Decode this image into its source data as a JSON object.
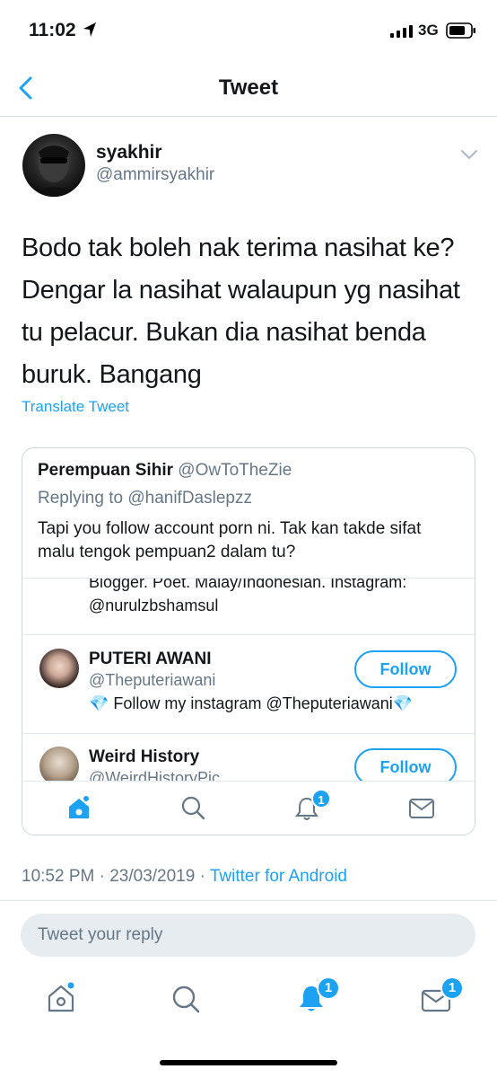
{
  "status_bar": {
    "time": "11:02",
    "network": "3G"
  },
  "nav": {
    "title": "Tweet"
  },
  "tweet": {
    "author_name": "syakhir",
    "author_handle": "@ammirsyakhir",
    "text": "Bodo tak boleh nak terima nasihat ke? Dengar la nasihat walaupun yg nasihat tu pelacur. Bukan dia nasihat benda buruk. Bangang",
    "translate_label": "Translate Tweet",
    "timestamp": "10:52 PM · 23/03/2019 · ",
    "source": "Twitter for Android"
  },
  "quoted": {
    "name": "Perempuan Sihir",
    "handle": "@OwToTheZie",
    "replying_prefix": "Replying to ",
    "replying_to": "@hanifDaslepzz",
    "text": "Tapi you follow account porn ni. Tak kan takde sifat malu tengok pempuan2 dalam tu?",
    "partial_bio": "Blogger. Poet. Malay/Indonesian. Instagram: @nurulzbshamsul",
    "users": [
      {
        "name": "PUTERI AWANI",
        "handle": "@Theputeriawani",
        "bio": "💎 Follow my instagram @Theputeriawani💎",
        "follow_label": "Follow"
      },
      {
        "name": "Weird History",
        "handle": "@WeirdHistoryPic",
        "follow_label": "Follow"
      }
    ],
    "notif_badge": "1"
  },
  "reply": {
    "placeholder": "Tweet your reply"
  },
  "tabbar": {
    "notif_badge": "1",
    "messages_badge": "1"
  },
  "colors": {
    "accent": "#1da1f2",
    "secondary_text": "#657786",
    "divider": "#e1e8ed"
  }
}
